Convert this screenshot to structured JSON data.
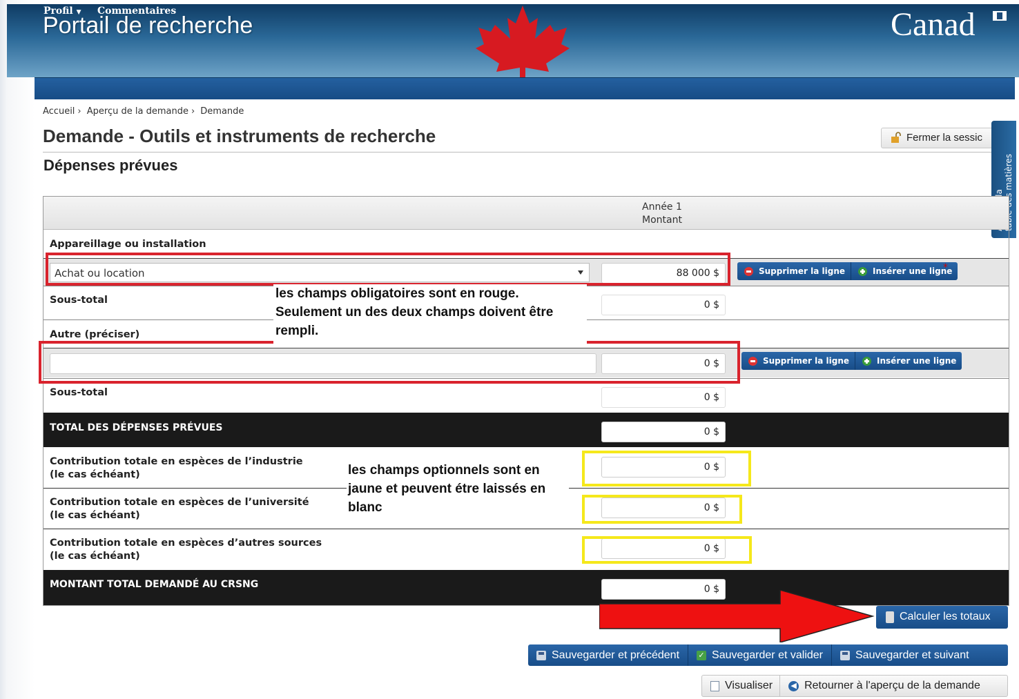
{
  "header": {
    "title": "Portail de recherche",
    "wordmark": "Canad"
  },
  "nav": {
    "profile": "Profil",
    "comments": "Commentaires"
  },
  "breadcrumb": [
    "Accueil",
    "Aperçu de la demande",
    "Demande"
  ],
  "page": {
    "title": "Demande - Outils et instruments de recherche",
    "section": "Dépenses prévues",
    "close_session": "Fermer la sessic",
    "toc_tab": [
      "Afficher la",
      "table des matières"
    ]
  },
  "table": {
    "header_line1": "Année 1",
    "header_line2": "Montant",
    "equipment": {
      "label": "Appareillage ou installation",
      "select_value": "Achat ou location",
      "amount": "88 000 $",
      "subtotal_label": "Sous-total",
      "subtotal": "0 $"
    },
    "other": {
      "label": "Autre (préciser)",
      "text_value": "",
      "amount": "0 $",
      "subtotal_label": "Sous-total",
      "subtotal": "0 $"
    },
    "row_buttons": {
      "delete": "Supprimer la ligne",
      "insert": "Insérer une ligne",
      "required_mark": "*"
    },
    "total_planned": {
      "label": "TOTAL DES DÉPENSES PRÉVUES",
      "value": "0 $"
    },
    "contrib_industry": {
      "line1": "Contribution totale en espèces de l’industrie",
      "line2": "(le cas échéant)",
      "value": "0 $"
    },
    "contrib_university": {
      "line1": "Contribution totale en espèces de l’université",
      "line2": "(le cas échéant)",
      "value": "0 $"
    },
    "contrib_other": {
      "line1": "Contribution totale en espèces d’autres sources",
      "line2": "(le cas échéant)",
      "value": "0 $"
    },
    "total_requested": {
      "label": "MONTANT TOTAL DEMANDÉ AU CRSNG",
      "value": "0 $"
    }
  },
  "annotations": {
    "red_note": [
      "les champs obligatoires sont en rouge.",
      "Seulement un des deux champs doivent être",
      "rempli."
    ],
    "yellow_note": [
      "les champs optionnels sont en",
      "jaune et peuvent étre laissés en",
      "blanc"
    ]
  },
  "buttons": {
    "calculate": "Calculer les totaux",
    "save_previous": "Sauvegarder et précédent",
    "save_validate": "Sauvegarder et valider",
    "save_next": "Sauvegarder et suivant",
    "preview": "Visualiser",
    "back_overview": "Retourner à l'aperçu de la demande"
  },
  "colors": {
    "header_dark": "#0f3b63",
    "nav_blue": "#1d5592",
    "maple_red": "#d71a21",
    "required_outline": "#d9232d",
    "optional_outline": "#f5e81b",
    "total_row": "#1a1a1a"
  }
}
